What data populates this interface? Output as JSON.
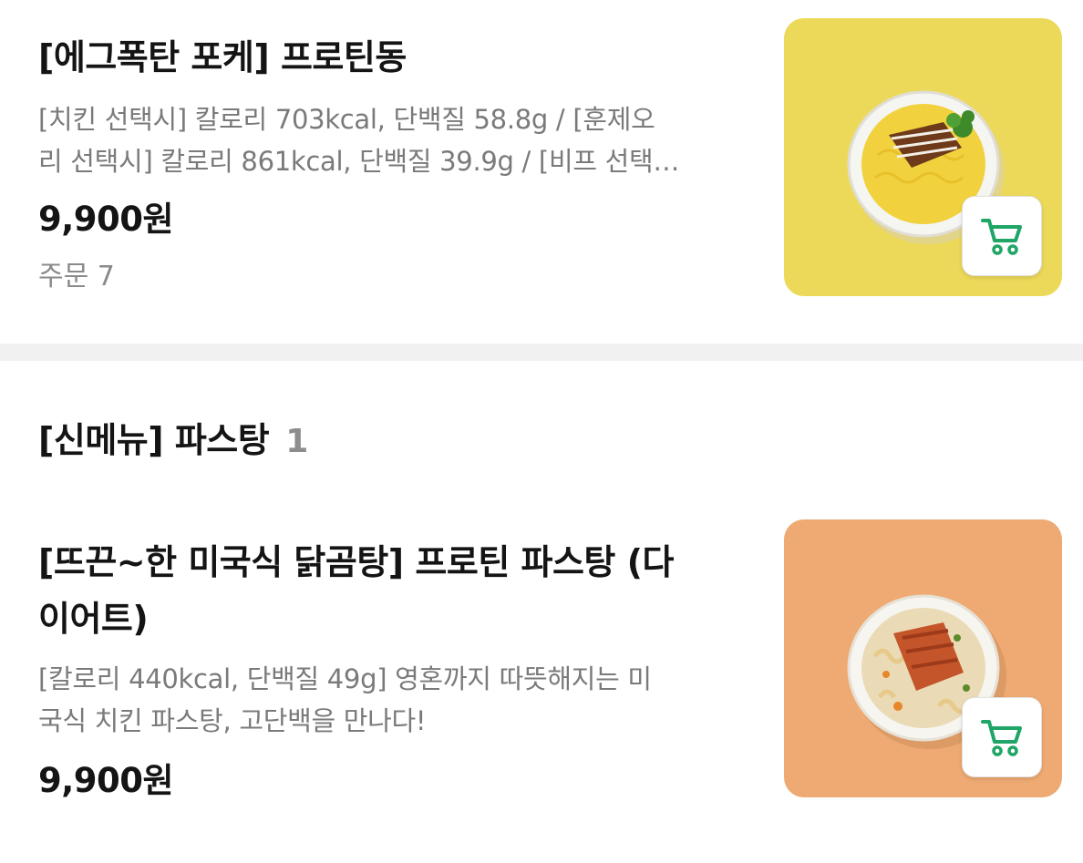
{
  "items": [
    {
      "title": "[에그폭탄 포케] 프로틴동",
      "desc_line1": "[치킨 선택시] 칼로리 703kcal, 단백질 58.8g / [훈제오",
      "desc_line2": "리 선택시] 칼로리 861kcal, 단백질 39.9g / [비프 선택…",
      "price": "9,900원",
      "orders": "주문 7",
      "image_bg": "#ecd95a",
      "image_desc": "rice-bowl-icon"
    },
    {
      "title_line1": "[뜨끈~한 미국식 닭곰탕] 프로틴 파스탕 (다",
      "title_line2": "이어트)",
      "desc_line1": "[칼로리 440kcal, 단백질 49g] 영혼까지 따뜻해지는 미",
      "desc_line2": "국식 치킨 파스탕, 고단백을 만나다!",
      "price": "9,900원",
      "image_bg": "#eeaa72",
      "image_desc": "pasta-bowl-icon"
    }
  ],
  "section": {
    "title": "[신메뉴] 파스탕",
    "count": "1"
  },
  "colors": {
    "cart_icon": "#1fa566",
    "divider": "#f1f1f1"
  },
  "icons": {
    "cart": "shopping-cart-icon"
  }
}
